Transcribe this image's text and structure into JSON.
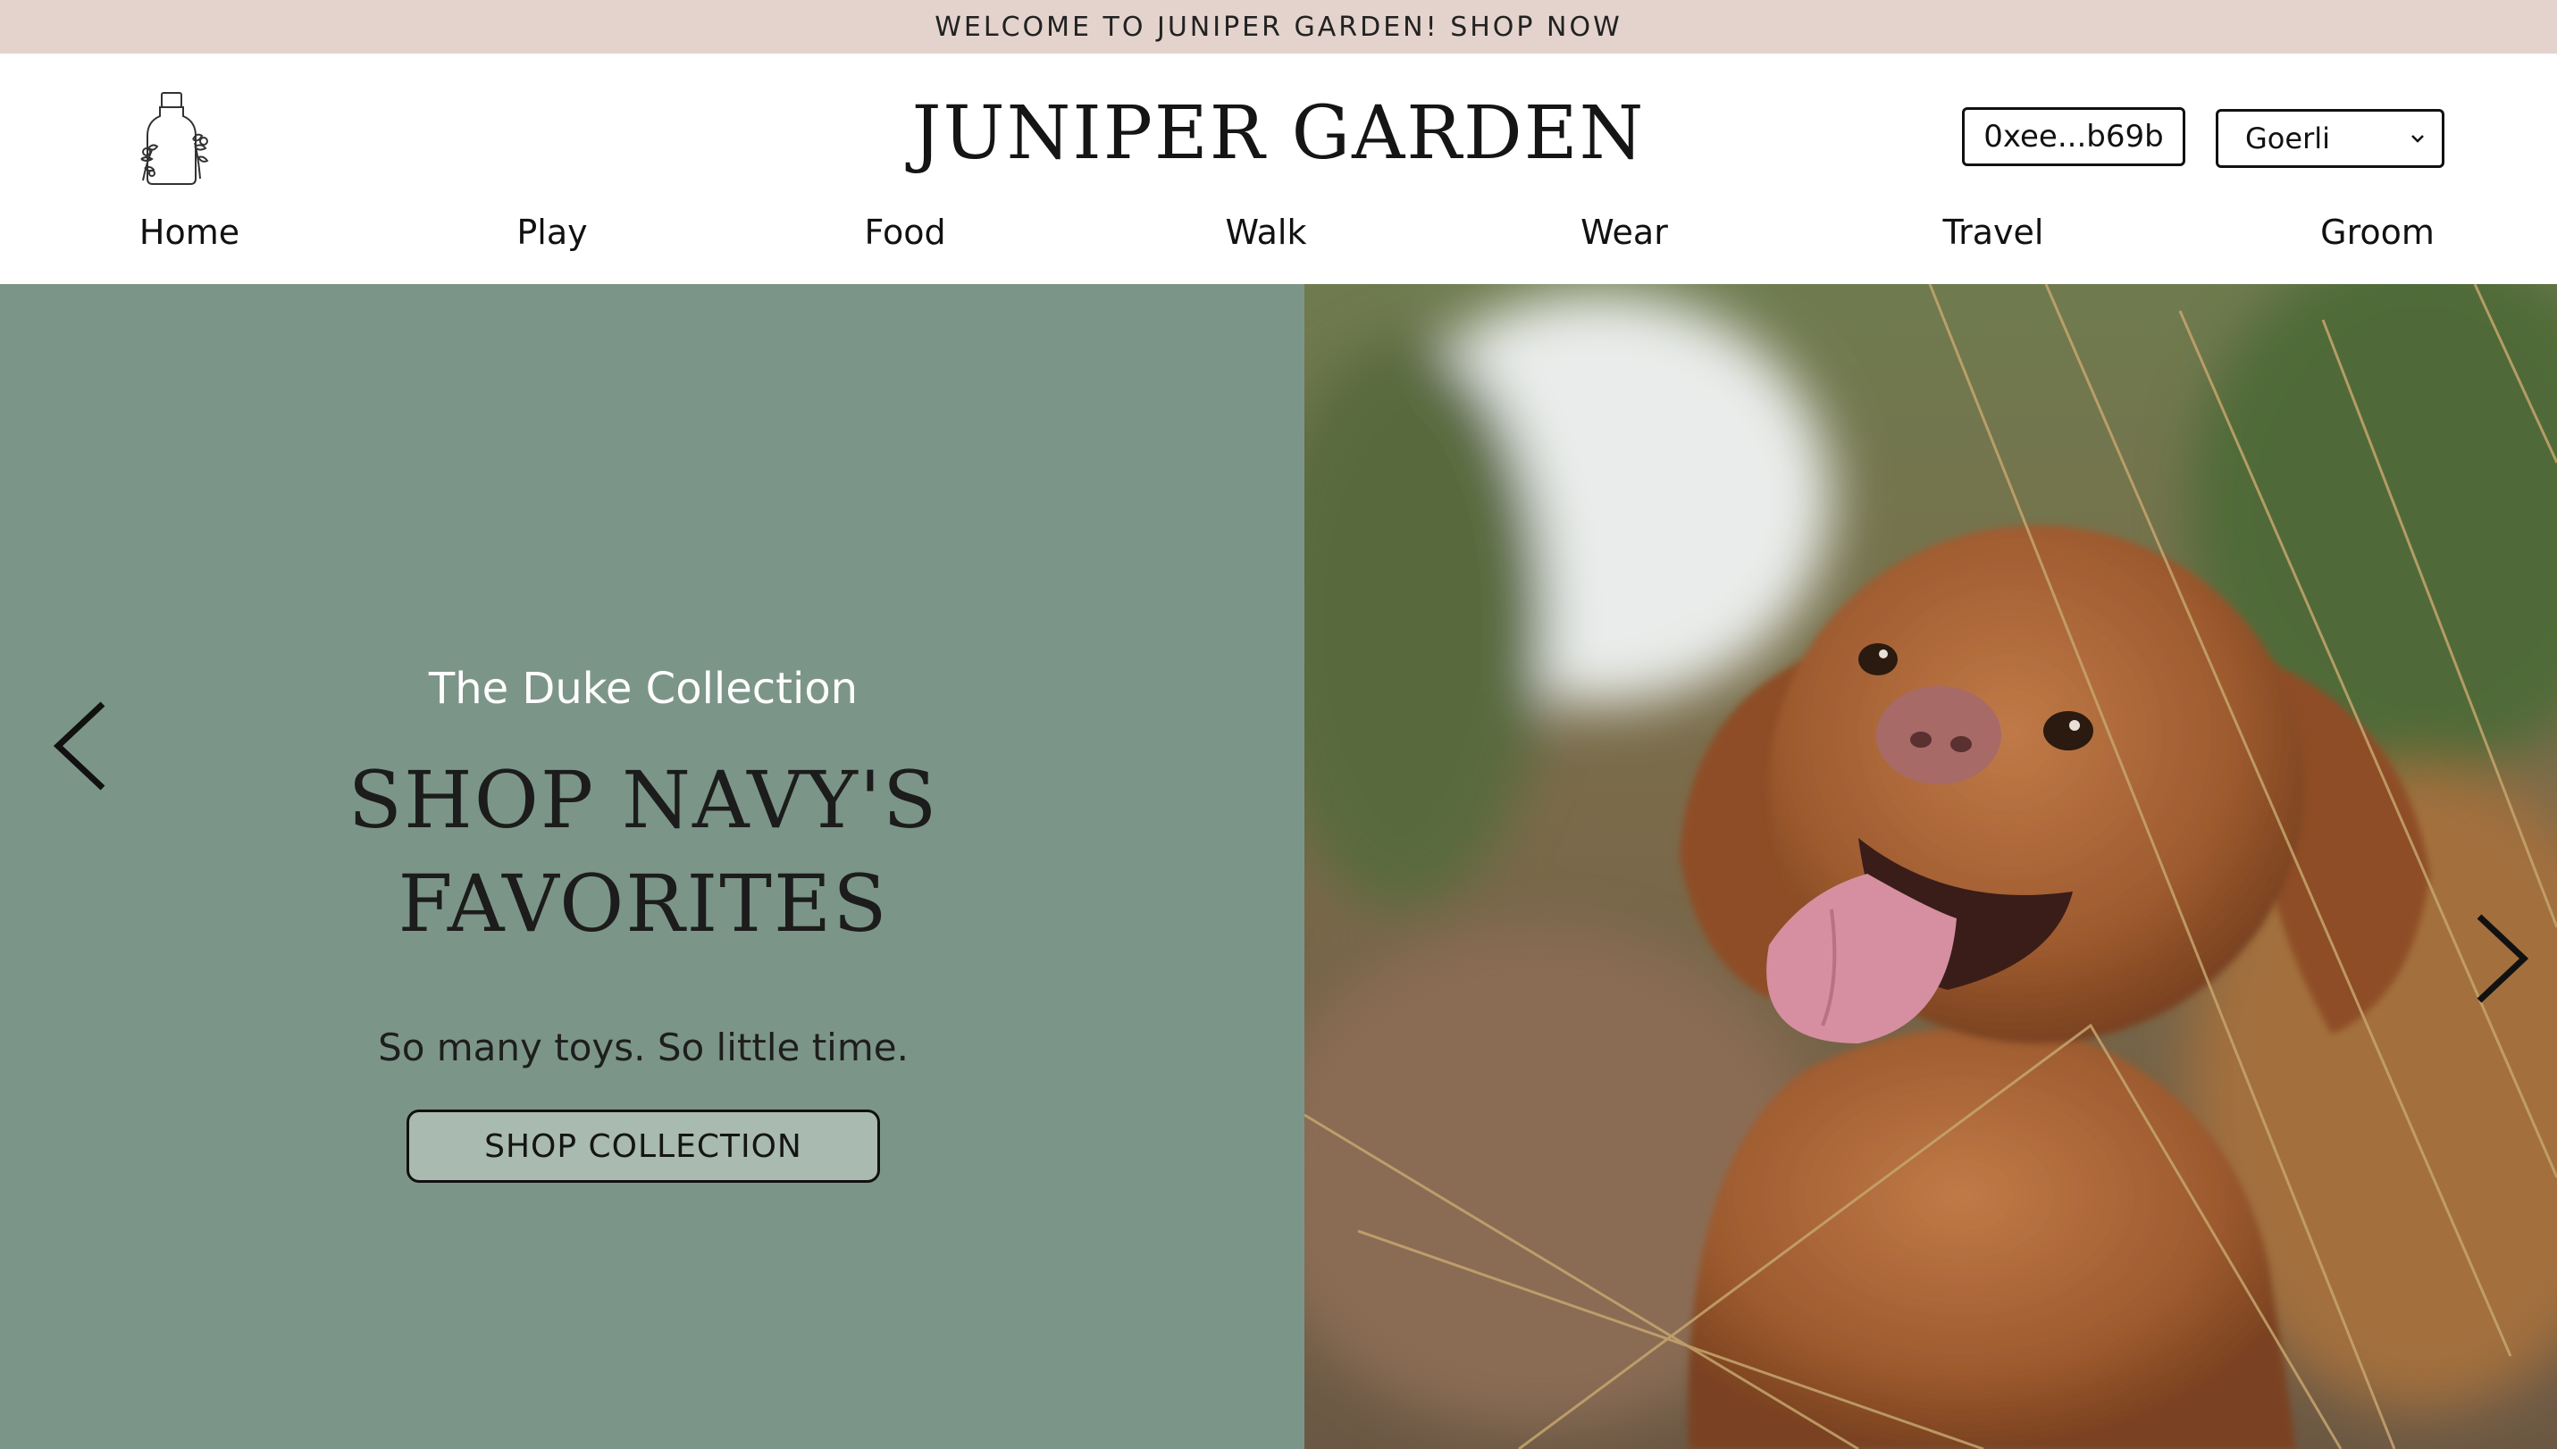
{
  "announcement": {
    "text": "WELCOME TO JUNIPER GARDEN! SHOP NOW"
  },
  "header": {
    "logo_icon": "bottle-with-flowers-icon",
    "brand": "JUNIPER GARDEN",
    "wallet_address": "0xee...b69b",
    "network": {
      "selected": "Goerli"
    }
  },
  "nav": {
    "items": [
      {
        "label": "Home"
      },
      {
        "label": "Play"
      },
      {
        "label": "Food"
      },
      {
        "label": "Walk"
      },
      {
        "label": "Wear"
      },
      {
        "label": "Travel"
      },
      {
        "label": "Groom"
      }
    ]
  },
  "hero": {
    "eyebrow": "The Duke Collection",
    "headline_line1": "SHOP NAVY'S",
    "headline_line2": "FAVORITES",
    "subtext": "So many toys. So little time.",
    "cta_label": "SHOP COLLECTION",
    "prev_icon": "chevron-left-icon",
    "next_icon": "chevron-right-icon",
    "image_subject": "dog-photo"
  },
  "colors": {
    "announcement_bg": "#e4d3cd",
    "hero_panel_bg": "#7c9589",
    "cta_bg": "#a9bab0"
  }
}
